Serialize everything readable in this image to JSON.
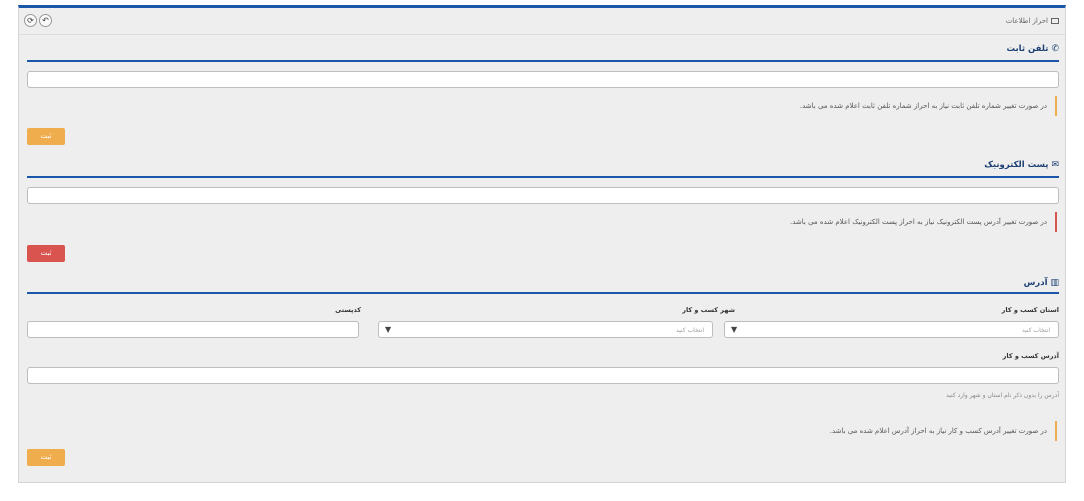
{
  "header": {
    "title": "احراز اطلاعات",
    "back_icon": "back-arrow-icon",
    "refresh_icon": "refresh-icon"
  },
  "landline": {
    "title": "تلفن ثابت",
    "icon": "phone-icon",
    "value": "",
    "note": "در صورت تغییر شماره تلفن ثابت نیاز به احراز شماره تلفن ثابت اعلام شده می باشد.",
    "submit": "ثبت",
    "accent": "#f0ad4e"
  },
  "email": {
    "title": "پست الکترونیک",
    "icon": "envelope-icon",
    "value": "",
    "note": "در صورت تغییر آدرس پست الکترونیک نیاز به احراز پست الکترونیک اعلام شده می باشد.",
    "submit": "ثبت",
    "accent": "#d9534f"
  },
  "address": {
    "title": "آدرس",
    "icon": "map-icon",
    "province_label": "استان کسب و کار",
    "province_value": "انتخاب کنید",
    "city_label": "شهر کسب و کار",
    "city_value": "انتخاب کنید",
    "postal_label": "کدپستی",
    "postal_value": "",
    "address_label": "آدرس کسب و کار",
    "address_value": "",
    "hint": "آدرس را بدون ذکر نام استان و شهر وارد کنید",
    "note": "در صورت تغییر آدرس کسب و کار نیاز به احراز آدرس اعلام شده می باشد.",
    "submit": "ثبت",
    "accent": "#f0ad4e"
  },
  "colors": {
    "primary": "#1b57a8",
    "title": "#1b3f73",
    "panel_bg": "#eeeeee"
  }
}
